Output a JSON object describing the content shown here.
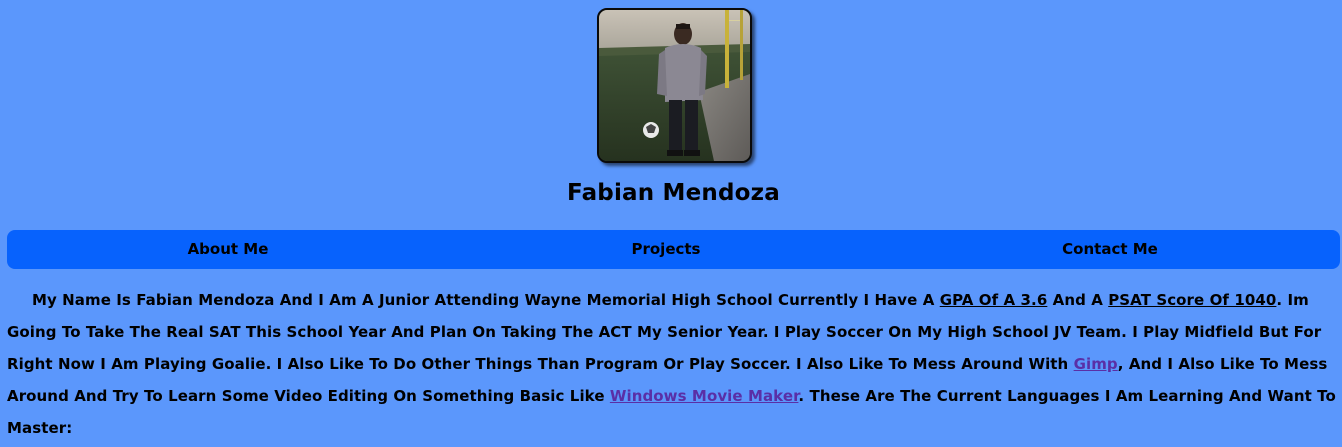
{
  "profile": {
    "name": "Fabian Mendoza",
    "photo_icon": "profile-photo"
  },
  "nav": {
    "items": [
      {
        "label": "About Me"
      },
      {
        "label": "Projects"
      },
      {
        "label": "Contact Me"
      }
    ]
  },
  "bio": {
    "part1": "My Name Is Fabian Mendoza And I Am A Junior Attending Wayne Memorial High School Currently I Have A ",
    "gpa": "GPA Of A 3.6",
    "part2": " And A ",
    "psat": "PSAT Score Of 1040",
    "part3": ". Im Going To Take The Real SAT This School Year And Plan On Taking The ACT My Senior Year. I Play Soccer On My High School JV Team. I Play Midfield But For Right Now I Am Playing Goalie. I Also Like To Do Other Things Than Program Or Play Soccer. I Also Like To Mess Around With ",
    "gimp_link": "Gimp",
    "part4": ", And I Also Like To Mess Around And Try To Learn Some Video Editing On Something Basic Like ",
    "wmm_link": "Windows Movie Maker",
    "part5": ". These Are The Current Languages I Am Learning And Want To Master:"
  },
  "colors": {
    "background": "#5b97fc",
    "nav_bar": "#0762fd",
    "visited_link": "#5a2fa6"
  }
}
